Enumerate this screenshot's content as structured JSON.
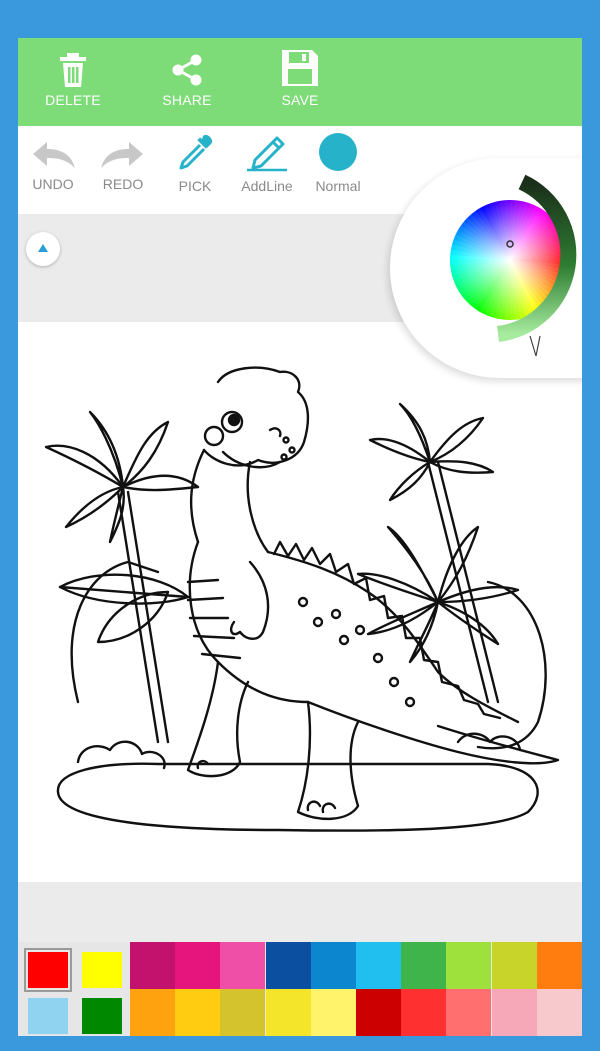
{
  "topbar": {
    "delete_label": "DELETE",
    "share_label": "SHARE",
    "save_label": "SAVE",
    "color": "#7ddc77"
  },
  "toolbar": {
    "undo_label": "UNDO",
    "redo_label": "REDO",
    "pick_label": "PICK",
    "addline_label": "AddLine",
    "normal_label": "Normal",
    "accent": "#26b3c9"
  },
  "palette": {
    "selected": [
      "#ff0000",
      "#ffff00"
    ],
    "secondary": [
      "#8fd3f0",
      "#008800"
    ],
    "row1": [
      "#c2126e",
      "#e6157d",
      "#ef4fa6",
      "#0a4fa0",
      "#0d86d0",
      "#20bff0",
      "#3fb44a",
      "#9ee03c",
      "#c9d42a",
      "#ff7d0f"
    ],
    "row2": [
      "#ffa20f",
      "#ffcc11",
      "#d4c32c",
      "#f5e52a",
      "#fff36b",
      "#cc0000",
      "#ff3030",
      "#ff6f6f",
      "#f7a8b8",
      "#f7c8cc"
    ]
  },
  "color_wheel": {
    "brightness_color": "#2e7d32"
  }
}
